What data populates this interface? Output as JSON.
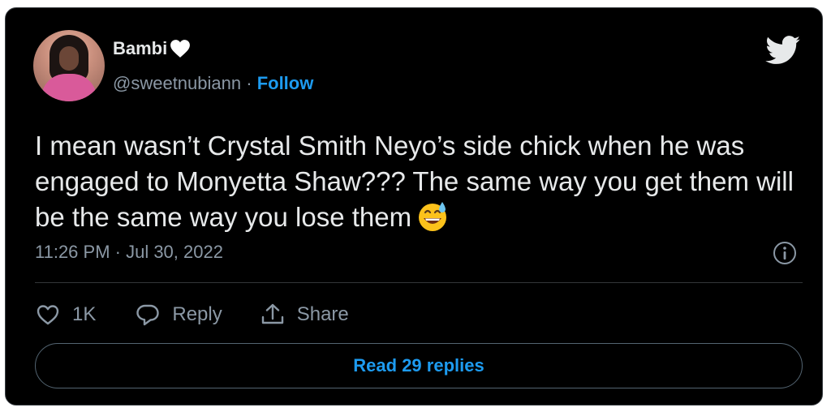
{
  "author": {
    "name": "Bambi",
    "handle": "@sweetnubiann",
    "separator": "·",
    "follow_label": "Follow",
    "verified_emoji": "heart-icon"
  },
  "tweet": {
    "text": "I mean wasn’t Crystal Smith Neyo’s side chick when he was engaged to Monyetta Shaw??? The same way you get them will be the same way you lose them",
    "emoji": "grinning-face-with-sweat-icon",
    "timestamp": "11:26 PM · Jul 30, 2022"
  },
  "actions": {
    "like_count": "1K",
    "reply_label": "Reply",
    "share_label": "Share"
  },
  "read_replies_label": "Read 29 replies",
  "colors": {
    "background": "#000000",
    "text": "#e7e9ea",
    "muted": "#8b98a5",
    "accent": "#1d9bf0",
    "border": "#536471"
  }
}
